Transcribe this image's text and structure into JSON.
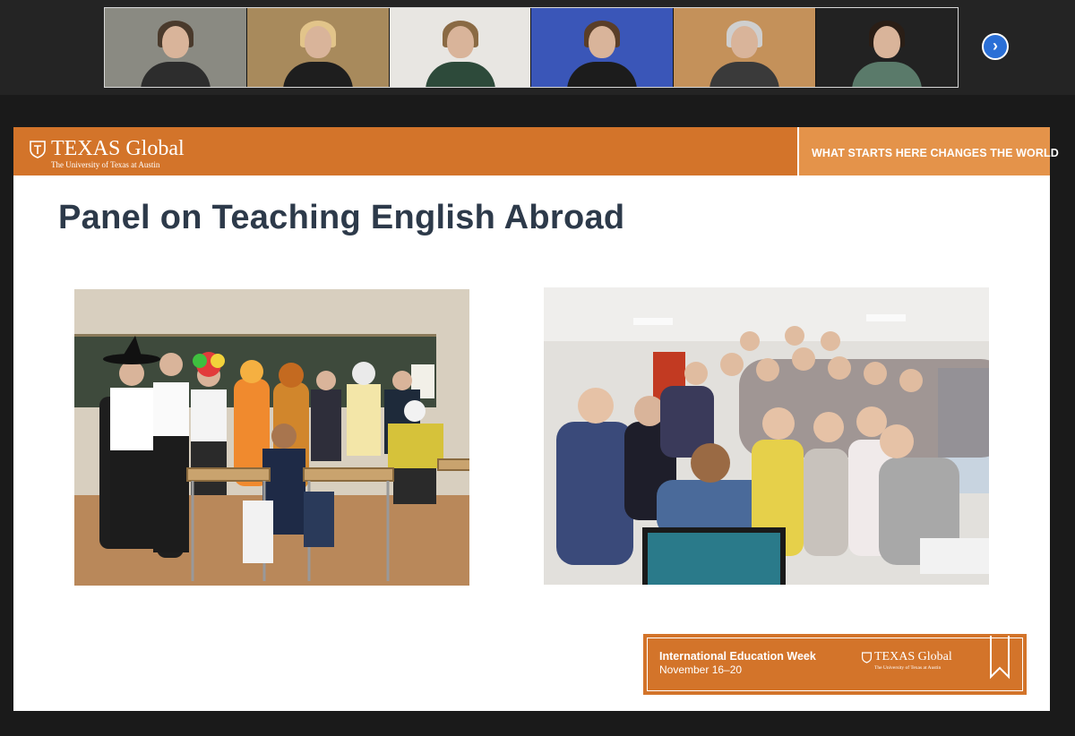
{
  "meeting": {
    "participants": [
      {
        "tile_colors": {
          "bg": "#8a8a82",
          "hair": "#4a3a2c",
          "torso": "#2d2d2d"
        }
      },
      {
        "tile_colors": {
          "bg": "#a88a5c",
          "hair": "#e2c48a",
          "torso": "#1e1e1e"
        },
        "active": true
      },
      {
        "tile_colors": {
          "bg": "#e8e6e2",
          "hair": "#8a6a44",
          "torso": "#2d4a3a"
        }
      },
      {
        "tile_colors": {
          "bg": "#3a56b8",
          "hair": "#5a3e28",
          "torso": "#1c1c1c"
        }
      },
      {
        "tile_colors": {
          "bg": "#c4915a",
          "hair": "#cfcfcf",
          "torso": "#3a3a3a"
        }
      },
      {
        "tile_colors": {
          "bg": "#222222",
          "hair": "#2a1e16",
          "torso": "#5a7a6a"
        }
      }
    ],
    "next_icon": "chevron-right-icon"
  },
  "slide": {
    "brand": {
      "word_main": "TEXAS Global",
      "word_sub": "The University of Texas at Austin"
    },
    "tagline": "WHAT STARTS HERE CHANGES THE WORLD",
    "title": "Panel on Teaching English Abroad",
    "photos": [
      {
        "name": "classroom-costume-group-photo"
      },
      {
        "name": "students-peace-sign-group-photo"
      }
    ],
    "footer": {
      "event": "International Education Week",
      "dates": "November 16–20",
      "logo_main": "TEXAS Global",
      "logo_sub": "The University of Texas at Austin"
    }
  },
  "colors": {
    "burnt_orange": "#d3742a",
    "banner_light": "#e4934a",
    "title_text": "#2d3a4a",
    "active_speaker": "#c8d630",
    "button_blue": "#2a6fd6"
  }
}
